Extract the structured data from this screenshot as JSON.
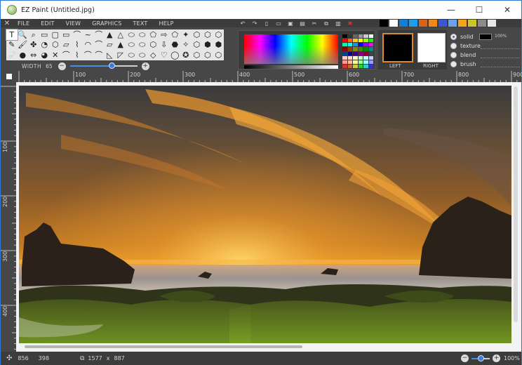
{
  "window": {
    "title": "EZ Paint (Untitled.jpg)",
    "controls": {
      "minimize": "—",
      "maximize": "☐",
      "close": "✕"
    }
  },
  "menu": {
    "close_glyph": "✕",
    "items": [
      "FILE",
      "EDIT",
      "VIEW",
      "GRAPHICS",
      "TEXT",
      "HELP"
    ]
  },
  "quick_access": [
    "undo-icon",
    "redo-icon",
    "new-file-icon",
    "open-folder-icon",
    "save-icon",
    "print-icon",
    "cut-icon",
    "copy-icon",
    "paste-icon",
    "clear-icon"
  ],
  "quick_glyphs": [
    "↶",
    "↷",
    "▯",
    "▭",
    "▣",
    "▤",
    "✂",
    "⧉",
    "▥",
    "✖"
  ],
  "swatch_strip": [
    "#000000",
    "#ffffff",
    "#0f7fd8",
    "#1aa0ee",
    "#d6651b",
    "#f08a12",
    "#3a56d0",
    "#6fa1ea",
    "#f3a31c",
    "#c9c72a",
    "#8b8b8b",
    "#e8e8e8"
  ],
  "shapes": {
    "glyphs": [
      "T",
      "🔍",
      "⌕",
      "▭",
      "▢",
      "▭",
      "⌒",
      "~",
      "⌒",
      "▲",
      "△",
      "⬭",
      "⬭",
      "⬠",
      "⇨",
      "⬠",
      "✦",
      "⬡",
      "⬡",
      "⬡",
      "✎",
      "🖌",
      "✤",
      "◔",
      "⬡",
      "▱",
      "⌇",
      "◠",
      "⌒",
      "▱",
      "▲",
      "⬭",
      "⬭",
      "⬡",
      "⇩",
      "⬣",
      "✧",
      "⬡",
      "⬢",
      "⬢",
      "🩹",
      "●",
      "⇔",
      "◕",
      "✕",
      "⌒",
      "⌇",
      "⌒",
      "⌒",
      "◺",
      "◸",
      "⬭",
      "⬭",
      "◇",
      "♡",
      "◯",
      "✪",
      "⬡",
      "⬡",
      "⬡"
    ],
    "selected_index": 0
  },
  "width": {
    "label": "WIDTH",
    "value": "65",
    "slider_fraction": 0.62,
    "minus": "−",
    "plus": "+"
  },
  "colors": {
    "left_label": "LEFT",
    "right_label": "RIGHT",
    "left": "#000000",
    "right": "#ffffff",
    "selected_border": "#d98a2a"
  },
  "mini_palette": [
    "#000",
    "#333",
    "#666",
    "#999",
    "#ccc",
    "#fff",
    "#f00",
    "#f60",
    "#fc0",
    "#ff0",
    "#9f0",
    "#0f0",
    "#0f9",
    "#0ff",
    "#09f",
    "#00f",
    "#90f",
    "#f0f",
    "#800",
    "#840",
    "#880",
    "#480",
    "#080",
    "#088",
    "#048",
    "#008",
    "#408",
    "#808",
    "#804",
    "#444",
    "#fcc",
    "#fdc",
    "#ffc",
    "#cfc",
    "#cff",
    "#ccf",
    "#f99",
    "#fb9",
    "#ff9",
    "#9f9",
    "#9ff",
    "#99f",
    "#c33",
    "#c63",
    "#cc3",
    "#3c3",
    "#3cc",
    "#33c"
  ],
  "fill_options": [
    {
      "label": "solid",
      "selected": true
    },
    {
      "label": "texture",
      "selected": false
    },
    {
      "label": "blend",
      "selected": false
    },
    {
      "label": "brush",
      "selected": false
    }
  ],
  "opacity": {
    "value": "100%"
  },
  "ruler_top": {
    "labels": [
      "100",
      "200",
      "300",
      "400",
      "500",
      "600",
      "700",
      "800",
      "900"
    ]
  },
  "ruler_left": {
    "labels": [
      "100",
      "200",
      "300",
      "400"
    ]
  },
  "status": {
    "cursor_x": "856",
    "cursor_y": "398",
    "image_width": "1577",
    "image_height": "887",
    "times": "x",
    "zoom_value": "100%",
    "zoom_slider_fraction": 0.5,
    "zoom_minus": "−",
    "zoom_plus": "+"
  }
}
